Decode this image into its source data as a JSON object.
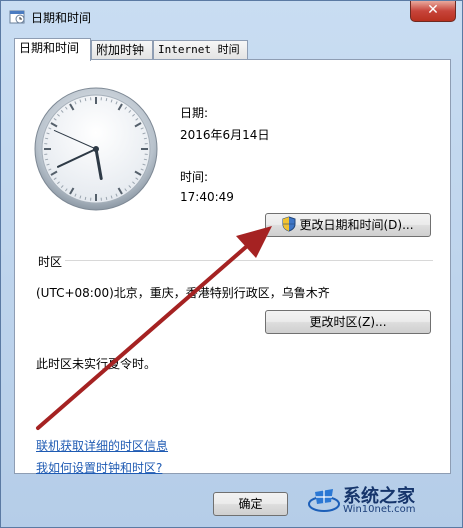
{
  "window": {
    "title": "日期和时间",
    "close_label": "✕"
  },
  "tabs": [
    {
      "label": "日期和时间",
      "active": true
    },
    {
      "label": "附加时钟",
      "active": false
    },
    {
      "label": "Internet 时间",
      "active": false
    }
  ],
  "datetime": {
    "date_label": "日期:",
    "date_value": "2016年6月14日",
    "time_label": "时间:",
    "time_value": "17:40:49",
    "change_button": "更改日期和时间(D)..."
  },
  "clock": {
    "hour": 17,
    "minute": 40,
    "second": 49
  },
  "timezone": {
    "section_label": "时区",
    "value": "(UTC+08:00)北京，重庆，香港特别行政区，乌鲁木齐",
    "change_button": "更改时区(Z)...",
    "dst_note": "此时区未实行夏令时。"
  },
  "links": {
    "online_info": "联机获取详细的时区信息",
    "how_to": "我如何设置时钟和时区?"
  },
  "footer": {
    "ok_button": "确定"
  },
  "watermark": {
    "brand": "系统之家",
    "site": "Win10net.com"
  },
  "colors": {
    "link": "#1f5bb3",
    "arrow": "#a52222",
    "window_frame": "#b9d1ea"
  }
}
